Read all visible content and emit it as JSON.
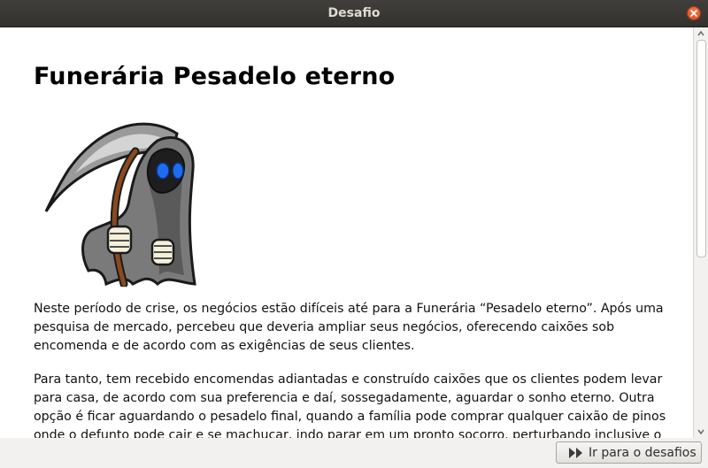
{
  "window": {
    "title": "Desafio"
  },
  "main": {
    "heading": "Funerária Pesadelo eterno",
    "paragraph1": "Neste período de crise, os negócios estão difíceis até para a Funerária “Pesadelo eterno”. Após uma pesquisa de mercado, percebeu que deveria ampliar seus negócios, oferecendo caixões sob encomenda e de acordo com as exigências de seus clientes.",
    "paragraph2": "Para tanto, tem recebido encomendas adiantadas e construído caixões que os clientes podem levar para casa, de acordo com sua preferencia e daí, sossegadamente, aguardar o sonho eterno. Outra opção é ficar aguardando o pesadelo final, quando a família pode comprar qualquer caixão de pinos onde o defunto pode cair e se machucar, indo parar em um pronto socorro, perturbando inclusive o"
  },
  "footer": {
    "button_label": "Ir para o desafios"
  },
  "icons": {
    "close": "close-icon",
    "button": "fast-forward-icon",
    "illustration": "grim-reaper-illustration"
  }
}
